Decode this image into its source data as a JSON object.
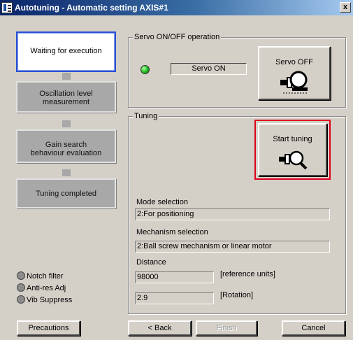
{
  "window": {
    "title": "Autotuning - Automatic setting AXIS#1",
    "close_glyph": "x"
  },
  "steps": [
    {
      "label": "Waiting for execution",
      "state": "active"
    },
    {
      "label_line1": "Oscillation level",
      "label_line2": "measurement",
      "state": "inactive"
    },
    {
      "label_line1": "Gain search",
      "label_line2": "behaviour evaluation",
      "state": "inactive"
    },
    {
      "label": "Tuning completed",
      "state": "inactive"
    }
  ],
  "indicators": [
    {
      "label": "Notch filter",
      "state": "off"
    },
    {
      "label": "Anti-res Adj",
      "state": "off"
    },
    {
      "label": "Vib Suppress",
      "state": "off"
    }
  ],
  "servo": {
    "group_title": "Servo ON/OFF operation",
    "status_text": "Servo ON",
    "led_color": "#29c52a",
    "button_label": "Servo OFF",
    "button_icon": "servo-motor-icon"
  },
  "tuning": {
    "group_title": "Tuning",
    "start_label": "Start tuning",
    "start_icon": "magnifier-motor-icon",
    "highlight_color": "#e0001b",
    "mode_label": "Mode selection",
    "mode_value": "2:For positioning",
    "mechanism_label": "Mechanism selection",
    "mechanism_value": "2:Ball screw mechanism or linear motor",
    "distance_label": "Distance",
    "distance_value": "98000",
    "distance_unit": "[reference units]",
    "rotation_value": "2.9",
    "rotation_unit": "[Rotation]"
  },
  "buttons": {
    "precautions": "Precautions",
    "back": "< Back",
    "finish": "Finish",
    "cancel": "Cancel"
  }
}
